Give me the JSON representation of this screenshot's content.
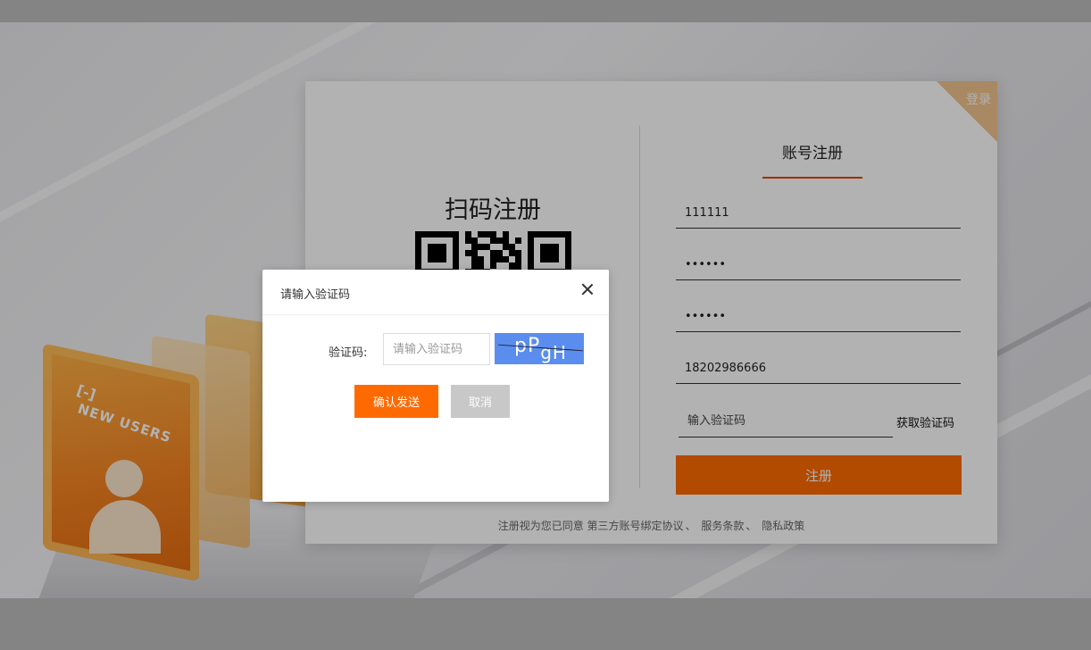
{
  "register_card": {
    "corner_label": "登录",
    "qr_title": "扫码注册",
    "tab_title": "账号注册",
    "fields": {
      "username": "111111",
      "password": "••••••",
      "confirm_password": "••••••",
      "phone": "18202986666"
    },
    "code_placeholder": "输入验证码",
    "get_code_label": "获取验证码",
    "register_label": "注册",
    "agreement": {
      "prefix": "注册视为您已同意",
      "link1": "第三方账号绑定协议",
      "link2": "服务条款",
      "link3": "隐私政策"
    }
  },
  "modal": {
    "title": "请输入验证码",
    "code_label": "验证码:",
    "code_placeholder": "请输入验证码",
    "captcha_text": "pP",
    "captcha_text_sub": "gH",
    "confirm_label": "确认发送",
    "cancel_label": "取消"
  },
  "hero": {
    "badge_text": "NEW USERS",
    "badge_logo": "[-]"
  },
  "colors": {
    "accent": "#ff6a00",
    "captcha_bg": "#5b8def",
    "corner": "#f1c48e",
    "tab_underline": "#e4420a"
  },
  "icons": [
    "close-icon",
    "qr-code-icon",
    "user-avatar-icon"
  ]
}
